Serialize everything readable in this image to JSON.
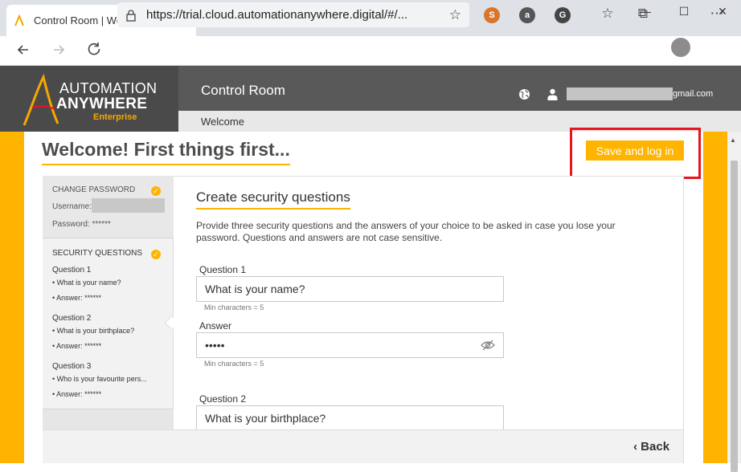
{
  "browser": {
    "tab_title": "Control Room | Welcome! First th",
    "tab_close": "✕",
    "new_tab": "+",
    "window_controls": [
      "—",
      "☐",
      "✕"
    ],
    "url": "https://trial.cloud.automationanywhere.digital/#/...",
    "extensions": [
      {
        "name": "ext-icon-1",
        "glyph": "S",
        "color": "#d9762b"
      },
      {
        "name": "ext-icon-2",
        "glyph": "a",
        "color": "#555555"
      },
      {
        "name": "ext-icon-3",
        "glyph": "G",
        "color": "#444444"
      }
    ],
    "icons": {
      "back": "back-arrow-icon",
      "forward": "forward-arrow-icon",
      "refresh": "refresh-icon",
      "favorites": "favorites-icon",
      "collections": "collections-icon",
      "menu": "more-menu-icon"
    }
  },
  "app": {
    "logo_line1": "AUTOMATION",
    "logo_line2": "ANYWHERE",
    "logo_line3": "Enterprise",
    "title": "Control Room",
    "breadcrumb": "Welcome",
    "user_email_suffix": "gmail.com",
    "accent_color": "#ffb400"
  },
  "page": {
    "title": "Welcome! First things first...",
    "save_button": "Save and log in",
    "back_button": "Back"
  },
  "sidebar": {
    "change_password": {
      "heading": "CHANGE PASSWORD",
      "username_label": "Username:",
      "password_label": "Password: ******"
    },
    "security_questions": {
      "heading": "SECURITY QUESTIONS",
      "items": [
        {
          "label": "Question 1",
          "question": "• What is your name?",
          "answer": "• Answer: ******"
        },
        {
          "label": "Question 2",
          "question": "• What is your birthplace?",
          "answer": "• Answer: ******"
        },
        {
          "label": "Question 3",
          "question": "• Who is your favourite pers...",
          "answer": "• Answer: ******"
        }
      ]
    }
  },
  "form": {
    "section_title": "Create security questions",
    "description": "Provide three security questions and the answers of your choice to be asked in case you lose your password. Questions and answers are not case sensitive.",
    "question1_label": "Question 1",
    "question1_value": "What is your name?",
    "question1_hint": "Min characters = 5",
    "answer1_label": "Answer",
    "answer1_value": "•••••",
    "answer1_hint": "Min characters = 5",
    "question2_label": "Question 2",
    "question2_value": "What is your birthplace?"
  }
}
